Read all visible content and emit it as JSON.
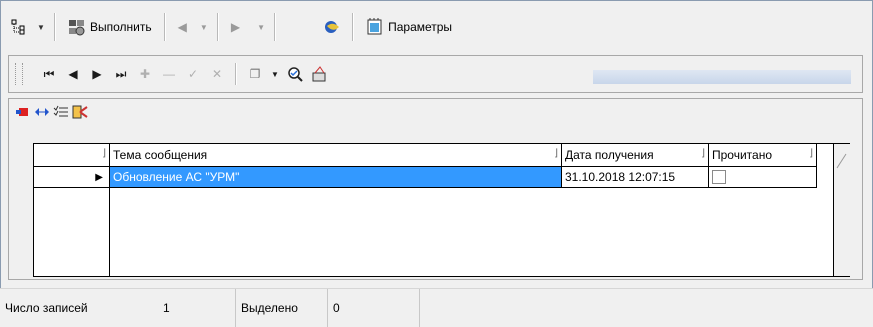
{
  "toolbar": {
    "tree_icon": "tree-icon",
    "run_label": "Выполнить",
    "params_label": "Параметры"
  },
  "navigator": {
    "buttons": [
      "first",
      "prior",
      "next",
      "last",
      "insert",
      "delete",
      "post",
      "cancel"
    ]
  },
  "grid": {
    "columns": [
      "Тема сообщения",
      "Дата получения",
      "Прочитано"
    ],
    "rows": [
      {
        "subject": "Обновление АС \"УРМ\"",
        "date": "31.10.2018 12:07:15",
        "read": false
      }
    ]
  },
  "status": {
    "count_label": "Число записей",
    "count_value": "1",
    "selected_label": "Выделено",
    "selected_value": "0"
  },
  "colors": {
    "selection": "#3399ff",
    "background": "#f0f0f0"
  }
}
